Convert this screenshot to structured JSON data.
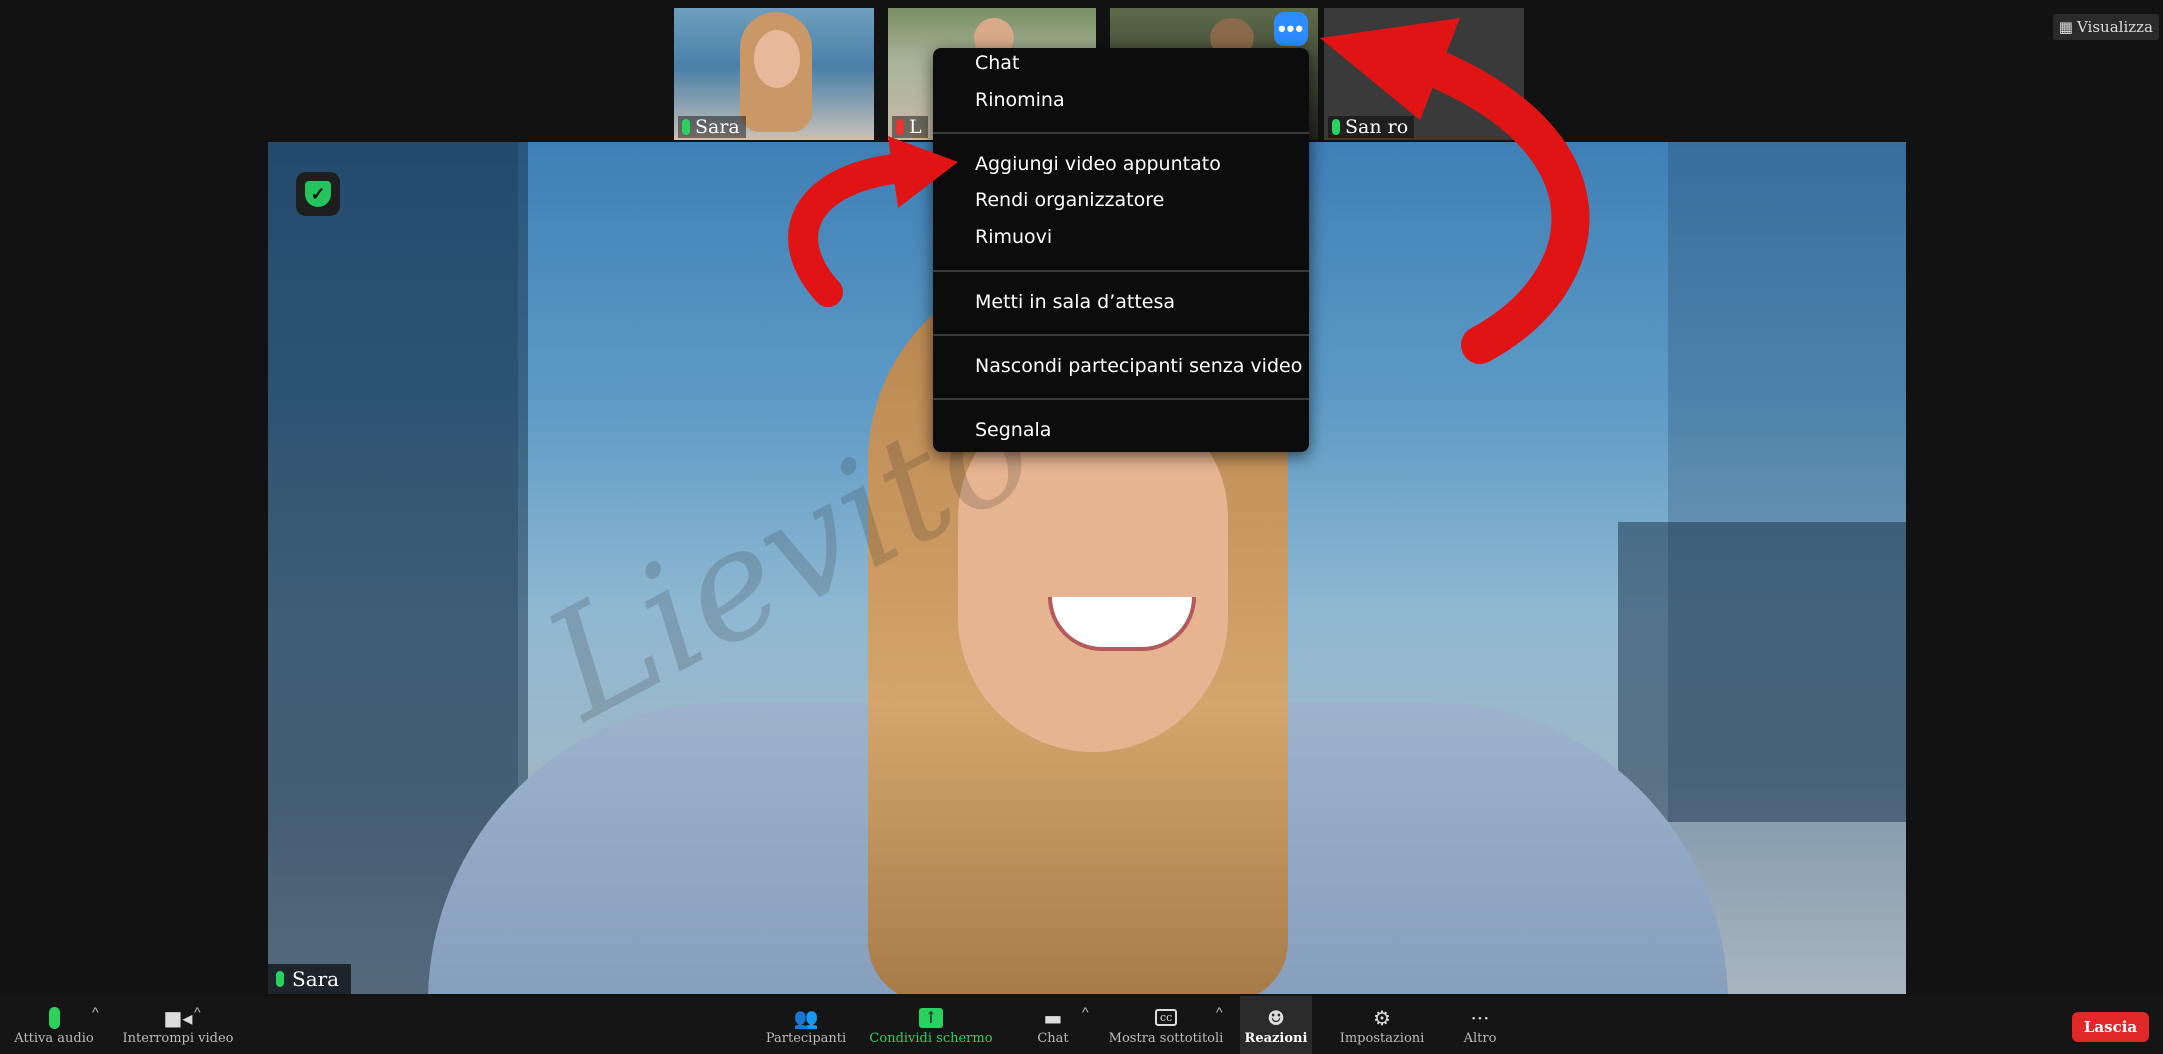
{
  "thumbnails": [
    {
      "name": "Sara",
      "muted": false
    },
    {
      "name": "L",
      "muted": true
    },
    {
      "name": "",
      "muted": false
    },
    {
      "name": "San ro",
      "muted": false
    }
  ],
  "top_right": {
    "view_label": "Visualizza"
  },
  "more_button": {
    "label": "•••"
  },
  "main_video": {
    "speaker_name": "Sara",
    "watermark": "Lievito"
  },
  "context_menu": {
    "items": [
      "Chat",
      "Rinomina",
      "Aggiungi video appuntato",
      "Rendi organizzatore",
      "Rimuovi",
      "Metti in sala d’attesa",
      "Nascondi partecipanti senza video",
      "Segnala"
    ]
  },
  "toolbar": {
    "audio": "Attiva audio",
    "video": "Interrompi video",
    "participants": "Partecipanti",
    "share": "Condividi schermo",
    "chat": "Chat",
    "captions": "Mostra sottotitoli",
    "reactions": "Reazioni",
    "settings": "Impostazioni",
    "more": "Altro",
    "leave": "Lascia"
  },
  "colors": {
    "accent": "#2d8cff",
    "share_green": "#2bd15f",
    "leave_red": "#e02828",
    "arrow_red": "#e01414"
  }
}
